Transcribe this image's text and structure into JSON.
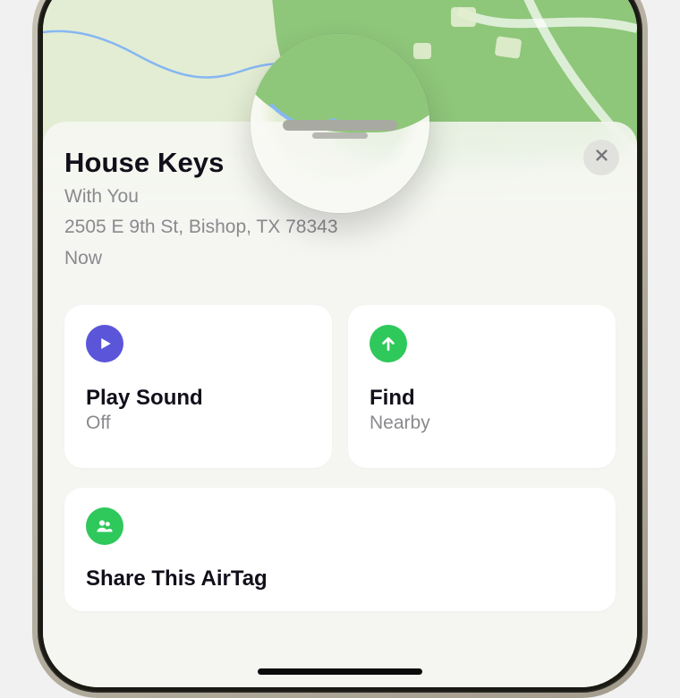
{
  "item": {
    "title": "House Keys",
    "status": "With You",
    "address": "2505 E 9th St, Bishop, TX 78343",
    "time": "Now"
  },
  "actions": {
    "play_sound": {
      "label": "Play Sound",
      "subtitle": "Off"
    },
    "find": {
      "label": "Find",
      "subtitle": "Nearby"
    }
  },
  "share": {
    "label": "Share This AirTag"
  },
  "colors": {
    "play_icon_bg": "#5a55d9",
    "find_icon_bg": "#2fc85b",
    "share_icon_bg": "#2fc85b"
  }
}
